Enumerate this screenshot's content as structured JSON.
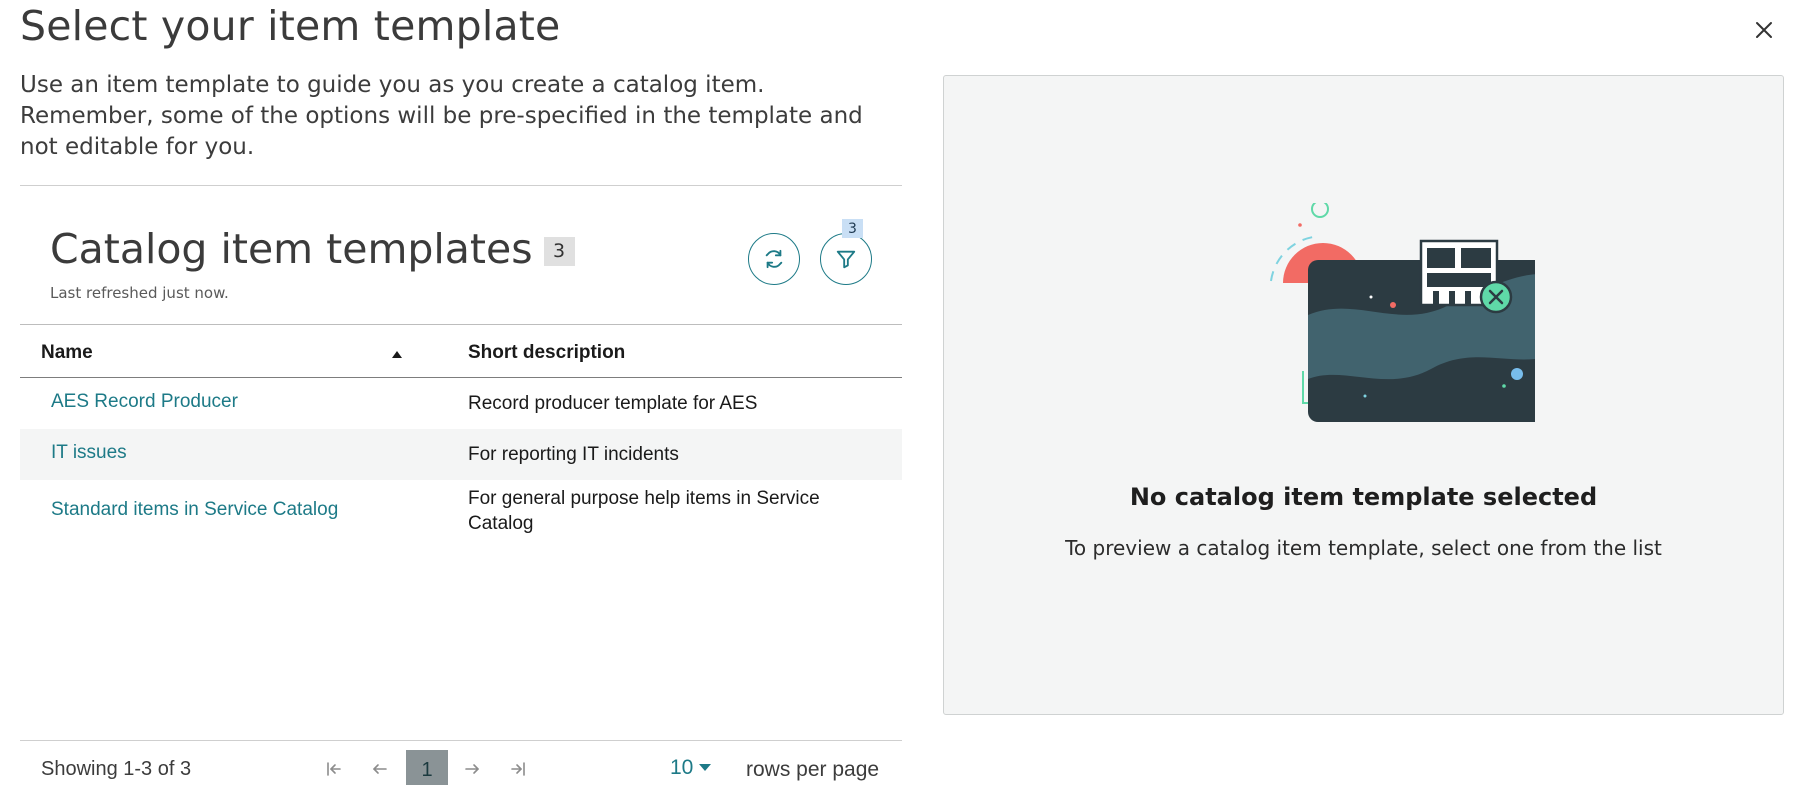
{
  "dialog": {
    "title": "Select your item template",
    "close_label": "Close",
    "intro": "Use an item template to guide you as you create a catalog item. Remember, some of the options will be pre-specified in the template and not editable for you."
  },
  "list": {
    "title": "Catalog item templates",
    "count": "3",
    "refreshed": "Last refreshed just now.",
    "filter_count": "3",
    "columns": [
      "Name",
      "Short description"
    ],
    "sort": "ascending",
    "rows": [
      {
        "name": "AES Record Producer",
        "description": "Record producer template for AES"
      },
      {
        "name": "IT issues",
        "description": "For reporting IT incidents"
      },
      {
        "name": "Standard items in Service Catalog",
        "description": "For general purpose help items in Service Catalog"
      }
    ]
  },
  "pagination": {
    "showing": "Showing 1-3 of 3",
    "current_page": "1",
    "rows_per_page": "10",
    "rows_per_page_label": "rows per page"
  },
  "preview": {
    "empty_title": "No catalog item template selected",
    "empty_description": "To preview a catalog item template, select one from the list"
  },
  "colors": {
    "accent": "#1d7a87",
    "coral": "#f26b64",
    "mint": "#5fd9a8",
    "card_dark": "#2c3b42",
    "card_mid": "#41636e"
  }
}
